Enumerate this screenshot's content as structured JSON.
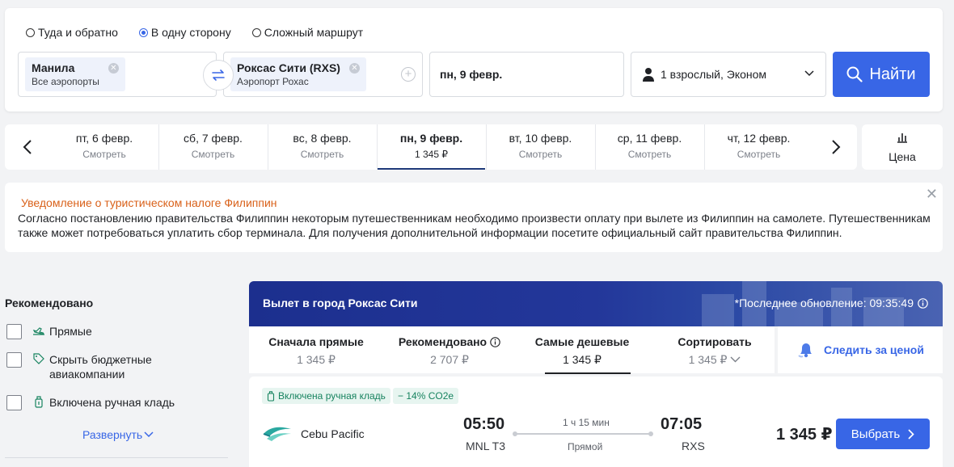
{
  "trip_types": [
    {
      "label": "Туда и обратно",
      "selected": false
    },
    {
      "label": "В одну сторону",
      "selected": true
    },
    {
      "label": "Сложный маршрут",
      "selected": false
    }
  ],
  "from": {
    "city": "Манила",
    "airport": "Все аэропорты"
  },
  "to": {
    "city": "Роксас Сити (RXS)",
    "airport": "Аэропорт Рохас"
  },
  "date": "пн, 9 февр.",
  "passengers": "1 взрослый, Эконом",
  "search_button": "Найти",
  "date_strip": [
    {
      "day": "пт, 6 февр.",
      "info": "Смотреть"
    },
    {
      "day": "сб, 7 февр.",
      "info": "Смотреть"
    },
    {
      "day": "вс, 8 февр.",
      "info": "Смотреть"
    },
    {
      "day": "пн, 9 февр.",
      "info": "1 345 ₽"
    },
    {
      "day": "вт, 10 февр.",
      "info": "Смотреть"
    },
    {
      "day": "ср, 11 февр.",
      "info": "Смотреть"
    },
    {
      "day": "чт, 12 февр.",
      "info": "Смотреть"
    }
  ],
  "price_toggle": "Цена",
  "notice": {
    "title": "Уведомление о туристическом налоге Филиппин",
    "body": "Согласно постановлению правительства Филиппин некоторым путешественникам необходимо произвести оплату при вылете из Филиппин на самолете. Путешественникам также может потребоваться уплатить сбор терминала. Для получения дополнительной информации посетите официальный сайт правительства Филиппин.",
    "close": "✕"
  },
  "filters": {
    "title": "Рекомендовано",
    "items": [
      "Прямые",
      "Скрыть бюджетные авиакомпании",
      "Включена ручная кладь"
    ],
    "expand": "Развернуть"
  },
  "results_header": {
    "title": "Вылет в город Роксас Сити",
    "updated": "*Последнее обновление: 09:35:49"
  },
  "sort_options": [
    {
      "label": "Сначала прямые",
      "value": "1 345 ₽"
    },
    {
      "label": "Рекомендовано",
      "value": "2 707 ₽"
    },
    {
      "label": "Самые дешевые",
      "value": "1 345 ₽"
    },
    {
      "label": "Сортировать",
      "value": "1 345 ₽"
    }
  ],
  "track_price": "Следить за ценой",
  "flight": {
    "badges": [
      "Включена ручная кладь",
      "− 14% CO2e"
    ],
    "airline": "Cebu Pacific",
    "depart_time": "05:50",
    "depart_code": "MNL T3",
    "duration": "1 ч 15 мин",
    "stops": "Прямой",
    "arrive_time": "07:05",
    "arrive_code": "RXS",
    "price": "1 345 ₽",
    "select": "Выбрать"
  },
  "colors": {
    "accent": "#3866e6",
    "notice_title": "#d9611a",
    "badge_green": "#17835f",
    "header_navy": "#1c2f8e"
  }
}
